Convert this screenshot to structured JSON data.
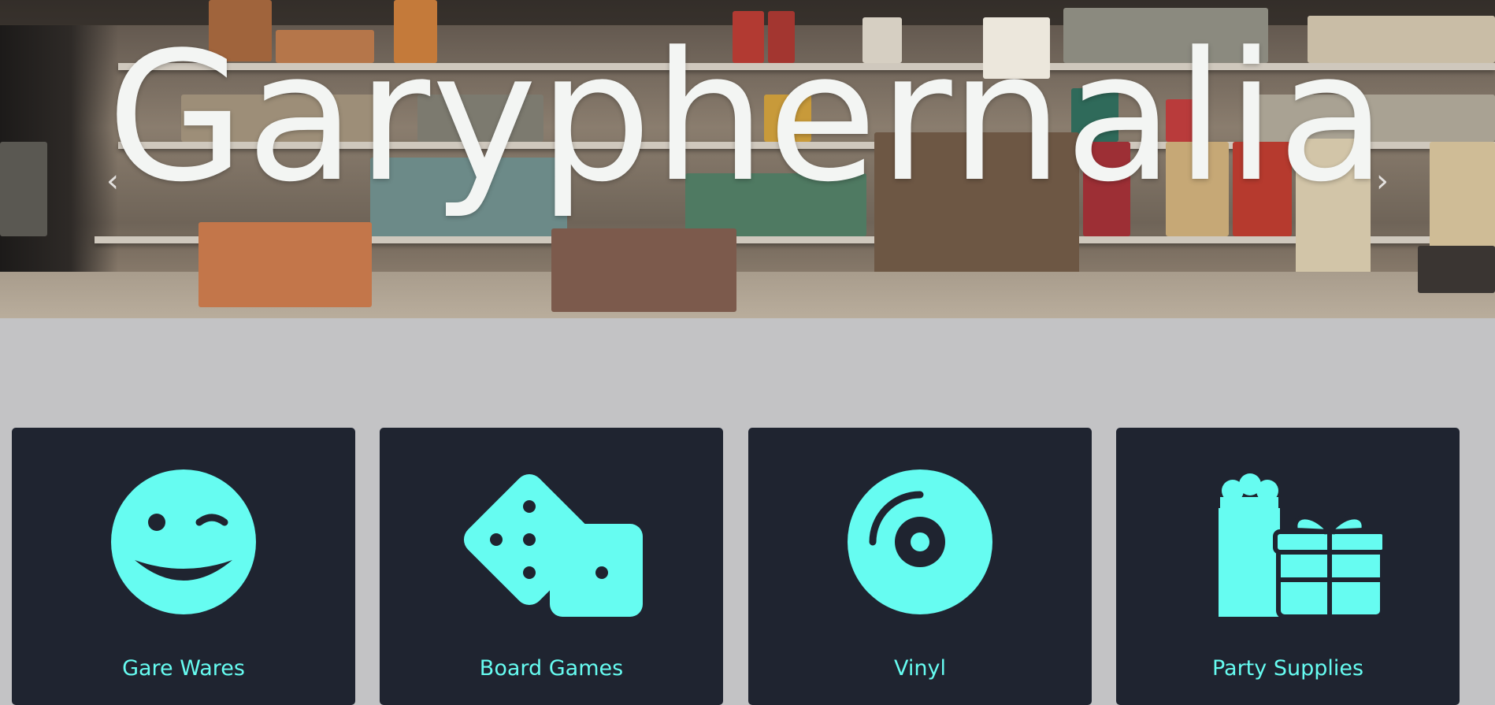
{
  "hero": {
    "title": "Garyphernalia",
    "prev_glyph": "‹",
    "next_glyph": "›"
  },
  "categories": [
    {
      "label": "Gare Wares",
      "icon": "winking-face-icon"
    },
    {
      "label": "Board Games",
      "icon": "dice-icon"
    },
    {
      "label": "Vinyl",
      "icon": "record-disc-icon"
    },
    {
      "label": "Party Supplies",
      "icon": "gifts-icon"
    }
  ],
  "colors": {
    "accent": "#66fcf1",
    "card_bg": "#1f2430",
    "page_bg": "#c3c3c5",
    "hero_text": "#f3f5f3"
  }
}
